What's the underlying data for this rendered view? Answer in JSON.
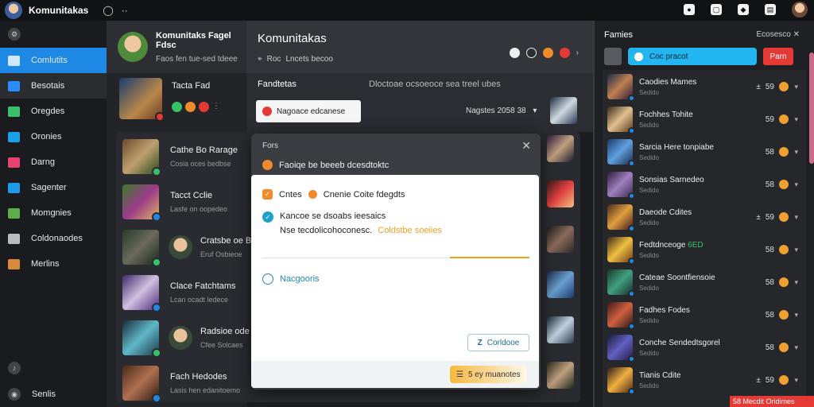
{
  "topbar": {
    "title": "Komunitakas",
    "icon_a": "◯",
    "icon_b": "··"
  },
  "sidebar": {
    "items": [
      {
        "label": "Comlutits",
        "icon": "home-icon",
        "color": "#cfe8ff",
        "active": true
      },
      {
        "label": "Besotais",
        "icon": "games-icon",
        "color": "#2a8cff"
      },
      {
        "label": "Oregdes",
        "icon": "leaf-icon",
        "color": "#38c16a"
      },
      {
        "label": "Oronies",
        "icon": "diamond-icon",
        "color": "#1aa0e8"
      },
      {
        "label": "Darng",
        "icon": "card-icon",
        "color": "#e84370"
      },
      {
        "label": "Sagenter",
        "icon": "chart-icon",
        "color": "#1e9be8"
      },
      {
        "label": "Momgnies",
        "icon": "map-icon",
        "color": "#5dae4a"
      },
      {
        "label": "Coldonaodes",
        "icon": "tool-icon",
        "color": "#bbbbbb"
      },
      {
        "label": "Merlins",
        "icon": "box-icon",
        "color": "#d88a3c"
      }
    ],
    "footer": "Senlis"
  },
  "mid": {
    "header": {
      "name": "Komunitaks Fagel Fdsc",
      "sub": "Faos fen tue-sed tdeee"
    },
    "featured": {
      "title": "Tacta Fad"
    },
    "rows": [
      {
        "title": "Cathe Bo Rarage",
        "sub": "Cosia oces bedbse"
      },
      {
        "title": "Tacct Cclie",
        "sub": "Lasfe on oopedeo"
      },
      {
        "title": "Cratsbe oe Bte",
        "sub": "Eruf Osbieoe",
        "avatar": true
      },
      {
        "title": "Clace Fatchtams",
        "sub": "Lcan ocadt ledece"
      },
      {
        "title": "Radsioe ode",
        "sub": "Cfee Solcaes",
        "avatar": true
      },
      {
        "title": "Fach Hedodes",
        "sub": "Lasis hen edanitoemo"
      }
    ]
  },
  "center": {
    "title": "Komunitakas",
    "sub_tag": "Roc",
    "sub_text": "Lncets becoo",
    "section_left": "Fandtetas",
    "section_right": "Dloctoae ocsoeoce sea treel ubes",
    "filter_label": "Nagoace edcanese",
    "date": "Nagstes 2058 38"
  },
  "modal": {
    "title": "Fors",
    "subtitle": "Faoiqe be beeeb dcesdtoktc",
    "check1_a": "Cntes",
    "check1_b": "Cnenie Coite fdegdts",
    "line2a": "Kancoe se dsoabs ieesaics",
    "line2b": "Nse tecdolicohoconesc.",
    "line2_link": "Coldstbe soeiies",
    "option": "Nacgooris",
    "btn_secondary": "Corldooe",
    "btn_primary": "5 ey muanotes"
  },
  "rpanel": {
    "title": "Famies",
    "right": "Ecosesco",
    "search": "Coc pracot",
    "red": "Parn",
    "rows": [
      {
        "title": "Caodies Mames",
        "sub": "Sedido",
        "num": "59",
        "pre": "±"
      },
      {
        "title": "Fochhes Tohite",
        "sub": "Sedido",
        "num": "59"
      },
      {
        "title": "Sarcia Here tonpiabe",
        "sub": "Sedido",
        "num": "58"
      },
      {
        "title": "Sonsias Sarnedeo",
        "sub": "Sedido",
        "num": "58"
      },
      {
        "title": "Daeode Cdites",
        "sub": "Sedido",
        "num": "59",
        "pre": "±"
      },
      {
        "title": "Fedtdnceoge",
        "tag": "6ED",
        "sub": "Sedido",
        "num": "58"
      },
      {
        "title": "Cateae Soontfiensoie",
        "sub": "Sedido",
        "num": "58"
      },
      {
        "title": "Fadhes Fodes",
        "sub": "Sedido",
        "num": "58"
      },
      {
        "title": "Conche Sendedtsgorel",
        "sub": "Sedido",
        "num": "58"
      },
      {
        "title": "Tianis Cdite",
        "sub": "Sedido",
        "num": "59",
        "pre": "±"
      }
    ],
    "promo": "58 Mecdit Oridimes"
  }
}
